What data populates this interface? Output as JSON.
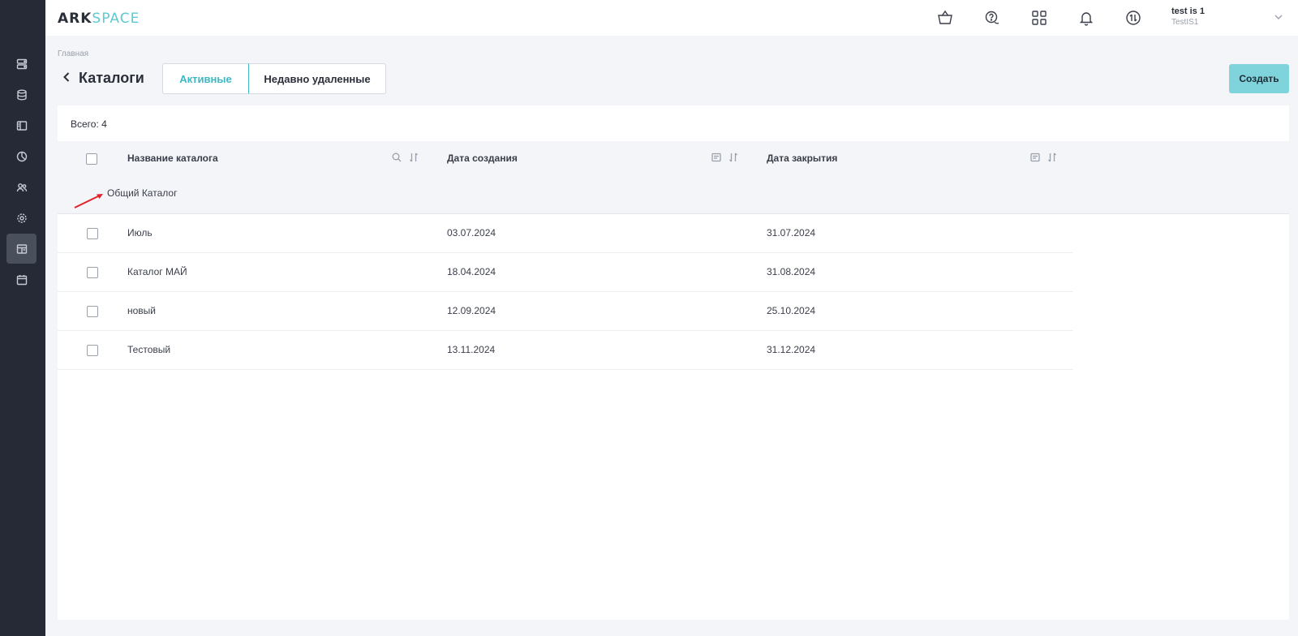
{
  "app": {
    "logo_ark": "ARK",
    "logo_space": "SPACE"
  },
  "sidebar": {
    "items": [
      {
        "icon": "server-icon",
        "active": false
      },
      {
        "icon": "database-icon",
        "active": false
      },
      {
        "icon": "layout-icon",
        "active": false
      },
      {
        "icon": "pie-chart-icon",
        "active": false
      },
      {
        "icon": "users-icon",
        "active": false
      },
      {
        "icon": "gear-icon",
        "active": false
      },
      {
        "icon": "catalog-icon",
        "active": true
      },
      {
        "icon": "calendar-icon",
        "active": false
      }
    ]
  },
  "header": {
    "icons": [
      "basket-icon",
      "help-chat-icon",
      "apps-grid-icon",
      "bell-icon",
      "sync-icon"
    ],
    "user_name": "test is 1",
    "user_org": "TestIS1"
  },
  "page": {
    "breadcrumb": "Главная",
    "title": "Каталоги",
    "tabs": [
      {
        "label": "Активные",
        "active": true
      },
      {
        "label": "Недавно удаленные",
        "active": false
      }
    ],
    "create_label": "Создать"
  },
  "table": {
    "total_text": "Всего: 4",
    "columns": [
      {
        "label": "Название каталога"
      },
      {
        "label": "Дата создания"
      },
      {
        "label": "Дата закрытия"
      }
    ],
    "group_label": "Общий Каталог",
    "rows": [
      {
        "name": "Июль",
        "created": "03.07.2024",
        "closed": "31.07.2024"
      },
      {
        "name": "Каталог МАЙ",
        "created": "18.04.2024",
        "closed": "31.08.2024"
      },
      {
        "name": "новый",
        "created": "12.09.2024",
        "closed": "25.10.2024"
      },
      {
        "name": "Тестовый",
        "created": "13.11.2024",
        "closed": "31.12.2024"
      }
    ]
  },
  "colors": {
    "accent": "#3bb8c3",
    "create_button": "#7fd4dc",
    "sidebar": "#262a36",
    "annotation_arrow": "#e0242c"
  }
}
